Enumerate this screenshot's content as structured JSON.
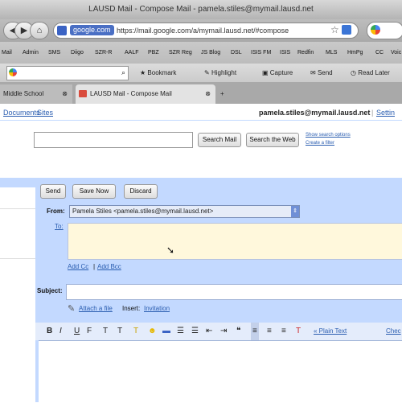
{
  "window": {
    "title": "LAUSD Mail - Compose Mail - pamela.stiles@mymail.lausd.net"
  },
  "nav": {
    "back": "◀",
    "forward": "▶",
    "home": "⌂",
    "site_badge": "google.com",
    "url": "https://mail.google.com/a/mymail.lausd.net/#compose"
  },
  "bookmarks": [
    "Mail",
    "Admin",
    "SMS",
    "Diigo",
    "SZR-R",
    "AALF",
    "PBZ",
    "SZR Reg",
    "JS Blog",
    "DSL",
    "ISIS FM",
    "ISIS",
    "Redfin",
    "MLS",
    "HmPg",
    "CC",
    "Voic"
  ],
  "google_toolbar": {
    "bookmark": "Bookmark",
    "highlight": "Highlight",
    "capture": "Capture",
    "send": "Send",
    "read_later": "Read Later"
  },
  "tabs": [
    {
      "label": "Middle School"
    },
    {
      "label": "LAUSD Mail - Compose Mail"
    }
  ],
  "header": {
    "links_left": [
      "Documents",
      "Sites"
    ],
    "user_email": "pamela.stiles@mymail.lausd.net",
    "settings": "Settin"
  },
  "search": {
    "search_mail": "Search Mail",
    "search_web": "Search the Web",
    "show_options": "Show search options",
    "create_filter": "Create a filter"
  },
  "compose": {
    "send": "Send",
    "save_now": "Save Now",
    "discard": "Discard",
    "from_label": "From:",
    "from_value": "Pamela Stiles <pamela.stiles@mymail.lausd.net>",
    "to_label": "To:",
    "add_cc": "Add Cc",
    "separator": "|",
    "add_bcc": "Add Bcc",
    "subject_label": "Subject:",
    "attach": "Attach a file",
    "insert_label": "Insert:",
    "invitation": "Invitation",
    "plain_text": "« Plain Text",
    "check_spelling": "Chec"
  },
  "colors": {
    "compose_bg": "#c3d9ff",
    "link": "#2a5db0",
    "to_bg": "#fff8dc"
  },
  "icons": {
    "paperclip": "paperclip-icon",
    "star": "star-icon",
    "rss": "rss-icon"
  }
}
